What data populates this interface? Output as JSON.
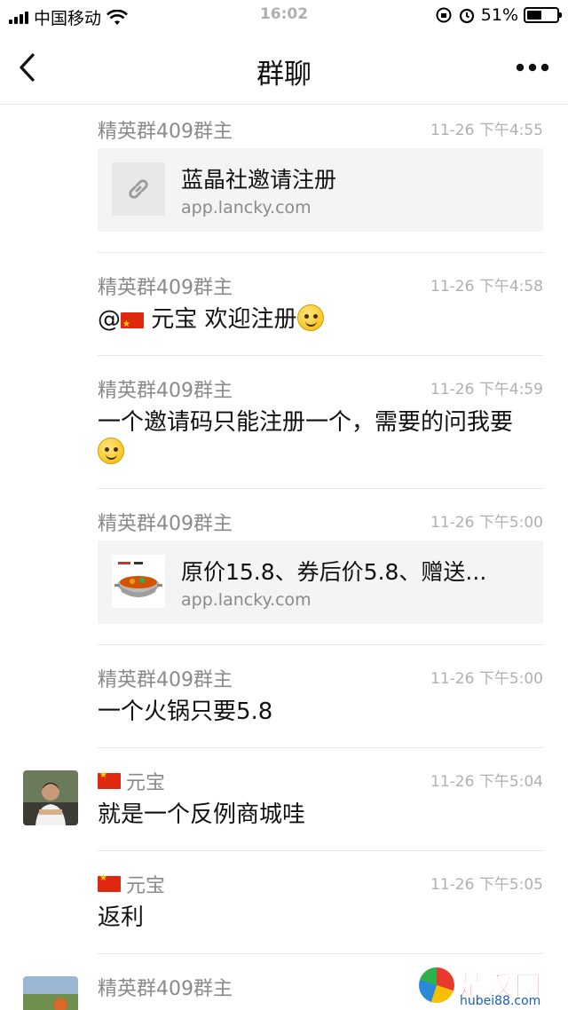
{
  "status_bar": {
    "carrier": "中国移动",
    "time": "16:02",
    "battery": "51%",
    "battery_level": 0.51
  },
  "nav": {
    "title": "群聊",
    "back_icon": "chevron-left-icon",
    "more_icon": "more-dots-icon"
  },
  "messages": [
    {
      "sender": "精英群409群主",
      "time": "11-26 下午4:55",
      "card": {
        "title": "蓝晶社邀请注册",
        "url": "app.lancky.com",
        "icon": "link-icon"
      }
    },
    {
      "sender": "精英群409群主",
      "time": "11-26 下午4:58",
      "mention": "@",
      "mention_name": "元宝",
      "text": "欢迎注册",
      "emoji": "thinking-face"
    },
    {
      "sender": "精英群409群主",
      "time": "11-26 下午4:59",
      "text": "一个邀请码只能注册一个，需要的问我要",
      "emoji": "smile-face"
    },
    {
      "sender": "精英群409群主",
      "time": "11-26 下午5:00",
      "card": {
        "title": "原价15.8、券后价5.8、赠送...",
        "url": "app.lancky.com",
        "icon": "hotpot-thumbnail"
      }
    },
    {
      "sender": "精英群409群主",
      "time": "11-26 下午5:00",
      "text": "一个火锅只要5.8"
    },
    {
      "sender": "元宝",
      "time": "11-26 下午5:04",
      "text": "就是一个反例商城哇"
    },
    {
      "sender": "元宝",
      "time": "11-26 下午5:05",
      "text": "返利"
    },
    {
      "sender": "精英群409群主",
      "time": ""
    }
  ],
  "watermark": {
    "text": "楚汉网",
    "url": "hubei88.com"
  }
}
